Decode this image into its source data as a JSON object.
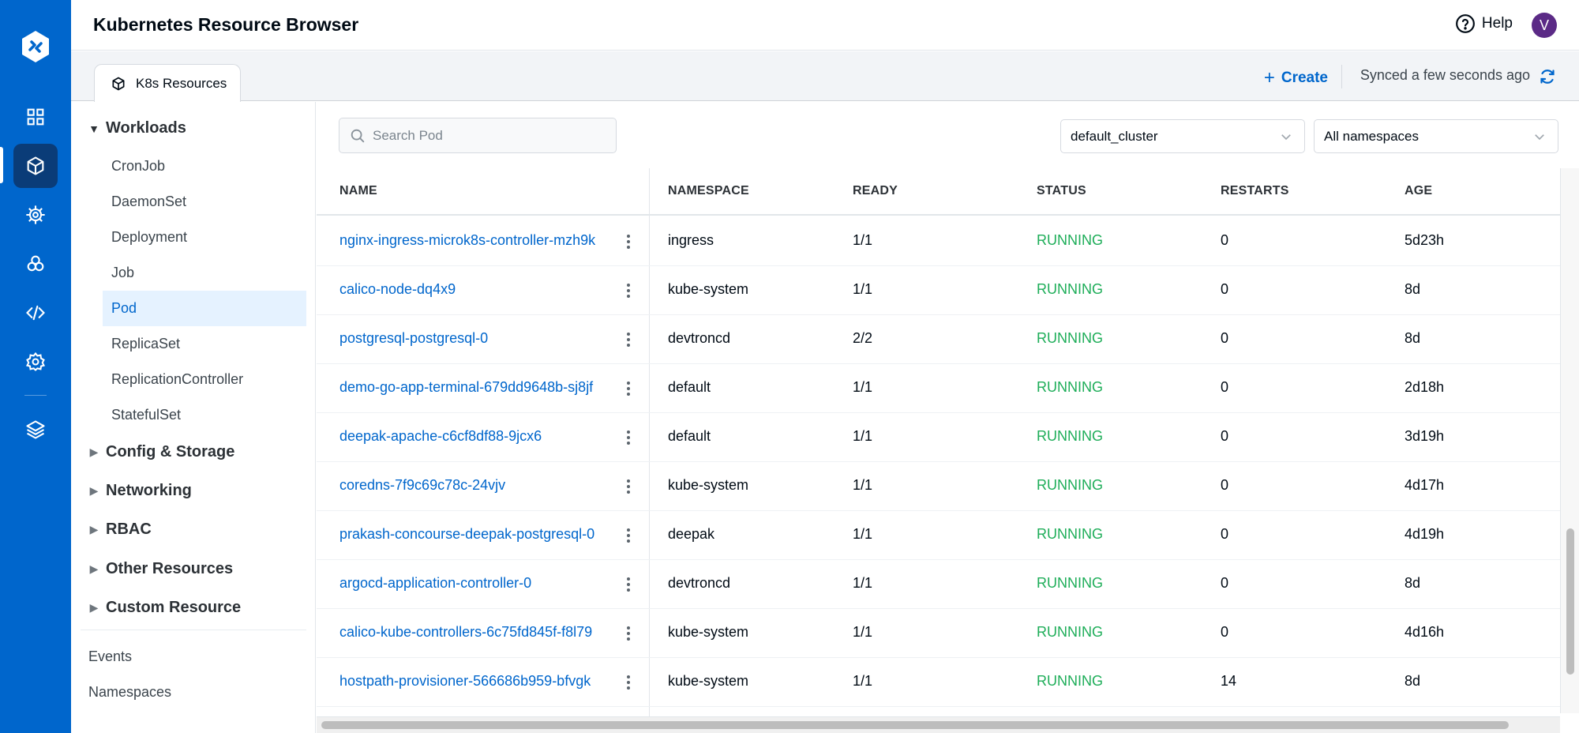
{
  "app": {
    "title": "Kubernetes Resource Browser",
    "help_label": "Help",
    "avatar_initial": "V",
    "brand_color": "#0066cc",
    "avatar_color": "#5b2a86"
  },
  "nav_rail": {
    "items": [
      {
        "icon": "grid-icon",
        "label": "Applications"
      },
      {
        "icon": "cube-icon",
        "label": "Resource Browser",
        "active": true
      },
      {
        "icon": "helm-wheel-icon",
        "label": "Charts"
      },
      {
        "icon": "cluster-icon",
        "label": "Clusters"
      },
      {
        "icon": "code-icon",
        "label": "Code"
      },
      {
        "icon": "gear-icon",
        "label": "Global Configurations"
      },
      {
        "icon": "layers-icon",
        "label": "Stack Manager"
      }
    ]
  },
  "tabbar": {
    "tab_label": "K8s Resources",
    "create_label": "Create",
    "synced_text": "Synced a few seconds ago"
  },
  "tree": {
    "workloads": {
      "label": "Workloads",
      "expanded": true,
      "items": [
        "CronJob",
        "DaemonSet",
        "Deployment",
        "Job",
        "Pod",
        "ReplicaSet",
        "ReplicationController",
        "StatefulSet"
      ],
      "selected": "Pod"
    },
    "groups": [
      "Config & Storage",
      "Networking",
      "RBAC",
      "Other Resources",
      "Custom Resource"
    ],
    "extras": [
      "Events",
      "Namespaces"
    ]
  },
  "main": {
    "search_placeholder": "Search Pod",
    "search_value": "",
    "cluster_select": "default_cluster",
    "namespace_select": "All namespaces",
    "columns": [
      "NAME",
      "NAMESPACE",
      "READY",
      "STATUS",
      "RESTARTS",
      "AGE"
    ],
    "status_color": "#1dad58",
    "rows": [
      {
        "name": "nginx-ingress-microk8s-controller-mzh9k",
        "namespace": "ingress",
        "ready": "1/1",
        "status": "RUNNING",
        "restarts": "0",
        "age": "5d23h"
      },
      {
        "name": "calico-node-dq4x9",
        "namespace": "kube-system",
        "ready": "1/1",
        "status": "RUNNING",
        "restarts": "0",
        "age": "8d"
      },
      {
        "name": "postgresql-postgresql-0",
        "namespace": "devtroncd",
        "ready": "2/2",
        "status": "RUNNING",
        "restarts": "0",
        "age": "8d"
      },
      {
        "name": "demo-go-app-terminal-679dd9648b-sj8jf",
        "namespace": "default",
        "ready": "1/1",
        "status": "RUNNING",
        "restarts": "0",
        "age": "2d18h"
      },
      {
        "name": "deepak-apache-c6cf8df88-9jcx6",
        "namespace": "default",
        "ready": "1/1",
        "status": "RUNNING",
        "restarts": "0",
        "age": "3d19h"
      },
      {
        "name": "coredns-7f9c69c78c-24vjv",
        "namespace": "kube-system",
        "ready": "1/1",
        "status": "RUNNING",
        "restarts": "0",
        "age": "4d17h"
      },
      {
        "name": "prakash-concourse-deepak-postgresql-0",
        "namespace": "deepak",
        "ready": "1/1",
        "status": "RUNNING",
        "restarts": "0",
        "age": "4d19h"
      },
      {
        "name": "argocd-application-controller-0",
        "namespace": "devtroncd",
        "ready": "1/1",
        "status": "RUNNING",
        "restarts": "0",
        "age": "8d"
      },
      {
        "name": "calico-kube-controllers-6c75fd845f-f8l79",
        "namespace": "kube-system",
        "ready": "1/1",
        "status": "RUNNING",
        "restarts": "0",
        "age": "4d16h"
      },
      {
        "name": "hostpath-provisioner-566686b959-bfvgk",
        "namespace": "kube-system",
        "ready": "1/1",
        "status": "RUNNING",
        "restarts": "14",
        "age": "8d"
      }
    ]
  }
}
